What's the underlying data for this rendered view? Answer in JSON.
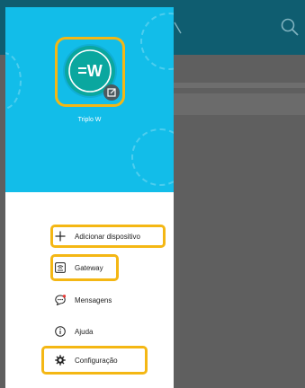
{
  "profile": {
    "name": "Triplo W",
    "logo_text": "=W"
  },
  "menu": {
    "items": [
      {
        "label": "Adicionar dispositivo",
        "icon": "plus-icon"
      },
      {
        "label": "Gateway",
        "icon": "gateway-icon"
      },
      {
        "label": "Mensagens",
        "icon": "messages-icon"
      },
      {
        "label": "Ajuda",
        "icon": "info-icon"
      },
      {
        "label": "Configuração",
        "icon": "gear-icon"
      }
    ]
  },
  "colors": {
    "header_bg": "#12bde9",
    "highlight": "#f4b714",
    "avatar_bg": "#0aa79f",
    "topbar": "#0f5d70",
    "overlay": "#5f5f5f"
  }
}
